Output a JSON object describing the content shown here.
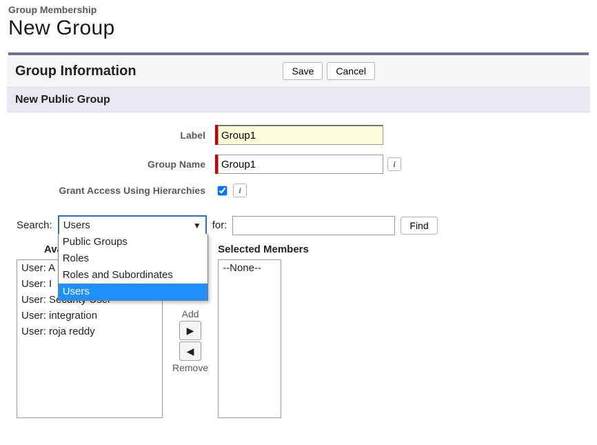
{
  "breadcrumb": "Group Membership",
  "page_title": "New Group",
  "section_title": "Group Information",
  "buttons": {
    "save": "Save",
    "cancel": "Cancel"
  },
  "sub_header": "New Public Group",
  "form": {
    "label_field": {
      "label": "Label",
      "value": "Group1"
    },
    "group_name": {
      "label": "Group Name",
      "value": "Group1"
    },
    "hierarchies": {
      "label": "Grant Access Using Hierarchies",
      "checked": true
    }
  },
  "search": {
    "label": "Search:",
    "selected": "Users",
    "options": [
      "Public Groups",
      "Roles",
      "Roles and Subordinates",
      "Users"
    ],
    "highlighted": "Users",
    "for_label": "for:",
    "for_value": "",
    "find": "Find"
  },
  "columns": {
    "available_title": "Available Members",
    "selected_title": "Selected Members",
    "available": [
      "User: A",
      "User: I",
      "User: Security User",
      "User: integration",
      "User: roja reddy"
    ],
    "selected": [
      "--None--"
    ]
  },
  "move": {
    "add": "Add",
    "remove": "Remove"
  },
  "info_char": "i"
}
